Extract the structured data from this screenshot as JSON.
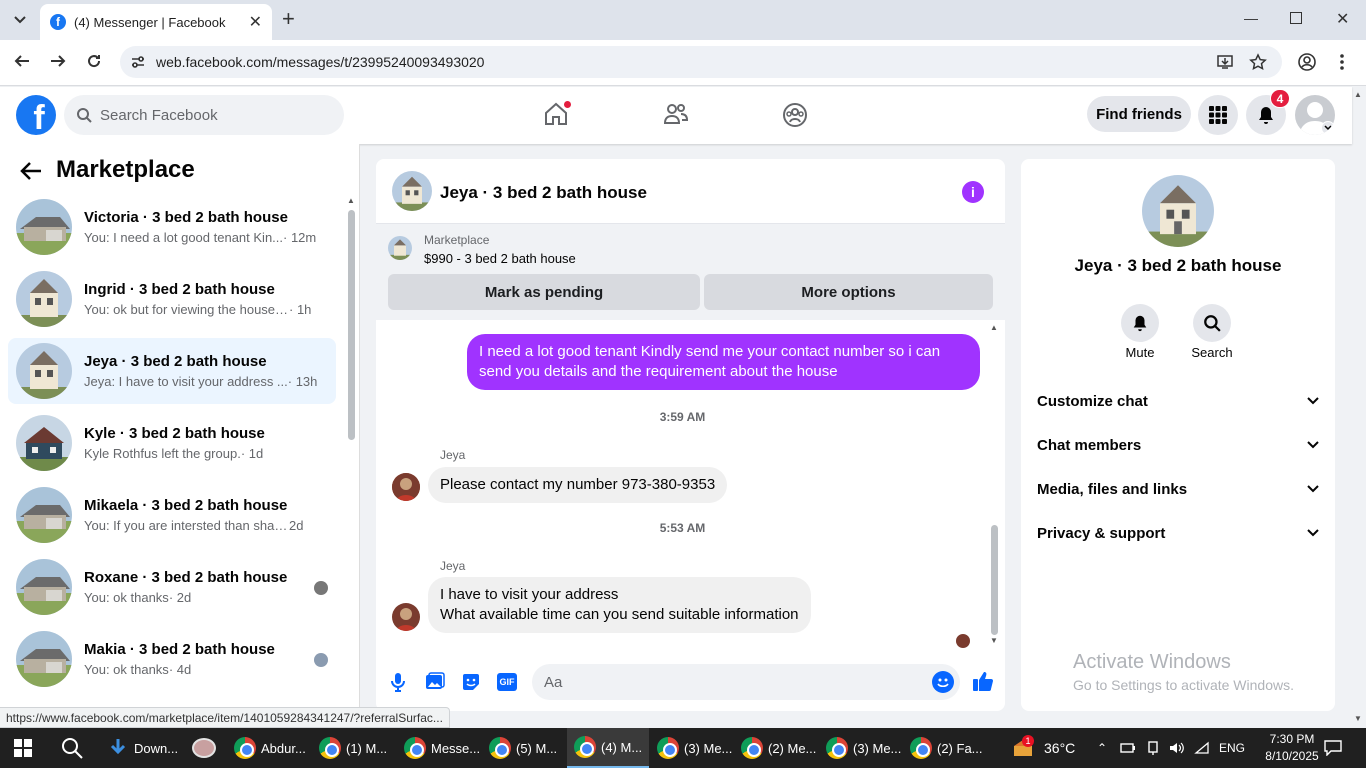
{
  "browser": {
    "tab_title": "(4) Messenger | Facebook",
    "url": "web.facebook.com/messages/t/23995240093493020",
    "status_url": "https://www.facebook.com/marketplace/item/1401059284341247/?referralSurfac..."
  },
  "header": {
    "search_placeholder": "Search Facebook",
    "find_friends": "Find friends",
    "notif_count": "4"
  },
  "sidebar": {
    "title": "Marketplace",
    "conversations": [
      {
        "name": "Victoria · 3 bed 2 bath house",
        "msg": "You: I need a lot good tenant Kin...",
        "time": " · 12m"
      },
      {
        "name": "Ingrid · 3 bed 2 bath house",
        "msg": "You: ok but for viewing the house i ...",
        "time": " · 1h"
      },
      {
        "name": "Jeya · 3 bed 2 bath house",
        "msg": "Jeya: I have to visit your address ...",
        "time": " · 13h"
      },
      {
        "name": "Kyle · 3 bed 2 bath house",
        "msg": "Kyle Rothfus left the group.",
        "time": " · 1d"
      },
      {
        "name": "Mikaela · 3 bed 2 bath house",
        "msg": "You: If you are intersted than share ...",
        "time": " 2d"
      },
      {
        "name": "Roxane · 3 bed 2 bath house",
        "msg": "You: ok thanks",
        "time": " · 2d"
      },
      {
        "name": "Makia · 3 bed 2 bath house",
        "msg": "You: ok thanks",
        "time": " · 4d"
      }
    ]
  },
  "chat": {
    "title": "Jeya · 3 bed 2 bath house",
    "listing_label": "Marketplace",
    "listing_price": "$990 - 3 bed 2 bath house",
    "mark_pending": "Mark as pending",
    "more_options": "More options",
    "messages": [
      {
        "text": "I need a lot good tenant Kindly send me your contact number so i can send you details and the requirement about the house"
      },
      {
        "time": "3:59 AM"
      },
      {
        "sender": "Jeya",
        "text": "Please contact my number 973-380-9353"
      },
      {
        "time": "5:53 AM"
      },
      {
        "sender": "Jeya",
        "line1": "I have to visit your address",
        "line2": "What available time can you send suitable information"
      }
    ],
    "composer_placeholder": "Aa"
  },
  "details": {
    "title": "Jeya · 3 bed 2 bath house",
    "mute": "Mute",
    "search": "Search",
    "sections": [
      "Customize chat",
      "Chat members",
      "Media, files and links",
      "Privacy & support"
    ],
    "watermark_title": "Activate Windows",
    "watermark_sub": "Go to Settings to activate Windows."
  },
  "taskbar": {
    "items": [
      "Down...",
      "Abdur...",
      "(1) M...",
      "Messe...",
      "(5) M...",
      "(4) M...",
      "(3) Me...",
      "(2) Me...",
      "(3) Me...",
      "(2) Fa..."
    ],
    "weather": "36°C",
    "weather_badge": "1",
    "lang": "ENG",
    "time": "7:30 PM",
    "date": "8/10/2025"
  },
  "colors": {
    "fb_blue": "#1877f2",
    "messenger_purple": "#a033ff",
    "selected_bg": "#ebf5ff"
  }
}
